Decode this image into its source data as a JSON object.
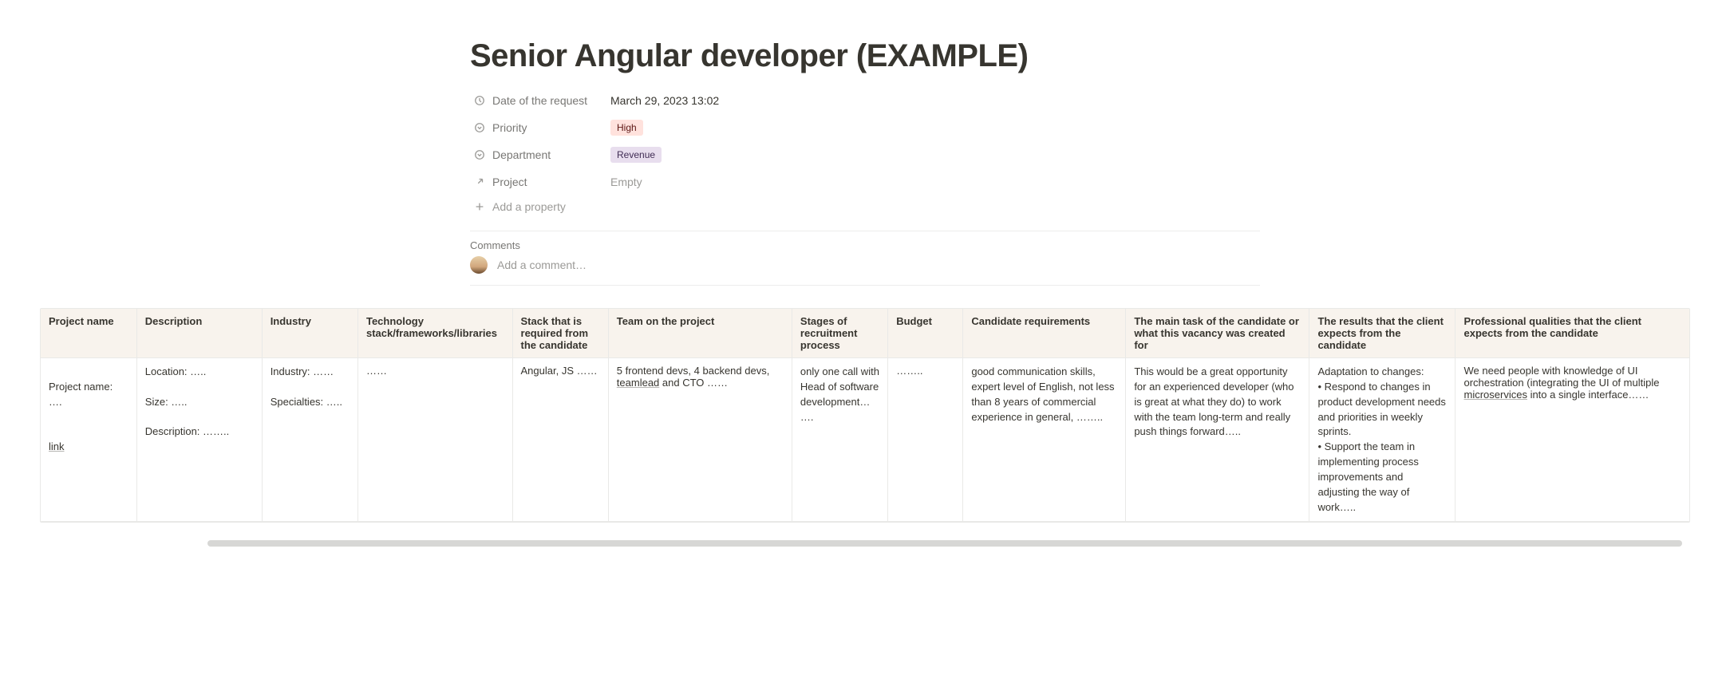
{
  "page_title": "Senior Angular developer (EXAMPLE)",
  "properties": {
    "date": {
      "label": "Date of the request",
      "value": "March 29, 2023 13:02"
    },
    "priority": {
      "label": "Priority",
      "value": "High"
    },
    "department": {
      "label": "Department",
      "value": "Revenue"
    },
    "project": {
      "label": "Project",
      "value": "Empty"
    }
  },
  "add_property_label": "Add a property",
  "comments": {
    "heading": "Comments",
    "placeholder": "Add a comment…"
  },
  "table": {
    "headers": [
      "Project name",
      "Description",
      "Industry",
      "Technology stack/frameworks/libraries",
      "Stack that is required from the candidate",
      "Team on the project",
      "Stages of recruitment process",
      "Budget",
      "Candidate requirements",
      "The main task of the candidate or what this vacancy was created for",
      "The results that the client expects from the candidate",
      "Professional qualities that the client expects from the candidate"
    ],
    "row": {
      "project_name": "Project name: ….\n\nlink",
      "description": "Location: …..\n\nSize: …..\n\nDescription: ……..",
      "industry": "Industry: ……\n\nSpecialties: …..",
      "tech": "……",
      "stack": "Angular, JS ……",
      "team_prefix": "5 frontend devs, 4 backend devs, ",
      "team_lead": "teamlead",
      "team_suffix": " and CTO ……",
      "stages": "only one call with Head of software development… ….",
      "budget": "……..",
      "cand_req": "good communication skills, expert level of English, not less than 8 years of commercial experience in general, ……..",
      "main_task": "This would be a great opportunity for an experienced developer (who is great at what they do) to work with the team long-term and really push things forward…..",
      "results": "Adaptation to changes:\n• Respond to changes in product development needs and priorities in weekly sprints.\n• Support the team in implementing process improvements and adjusting the way of work…..",
      "prof_prefix": "We need people with knowledge of UI orchestration (integrating the UI of multiple ",
      "prof_underlined": "microservices",
      "prof_suffix": " into a single interface……"
    }
  }
}
